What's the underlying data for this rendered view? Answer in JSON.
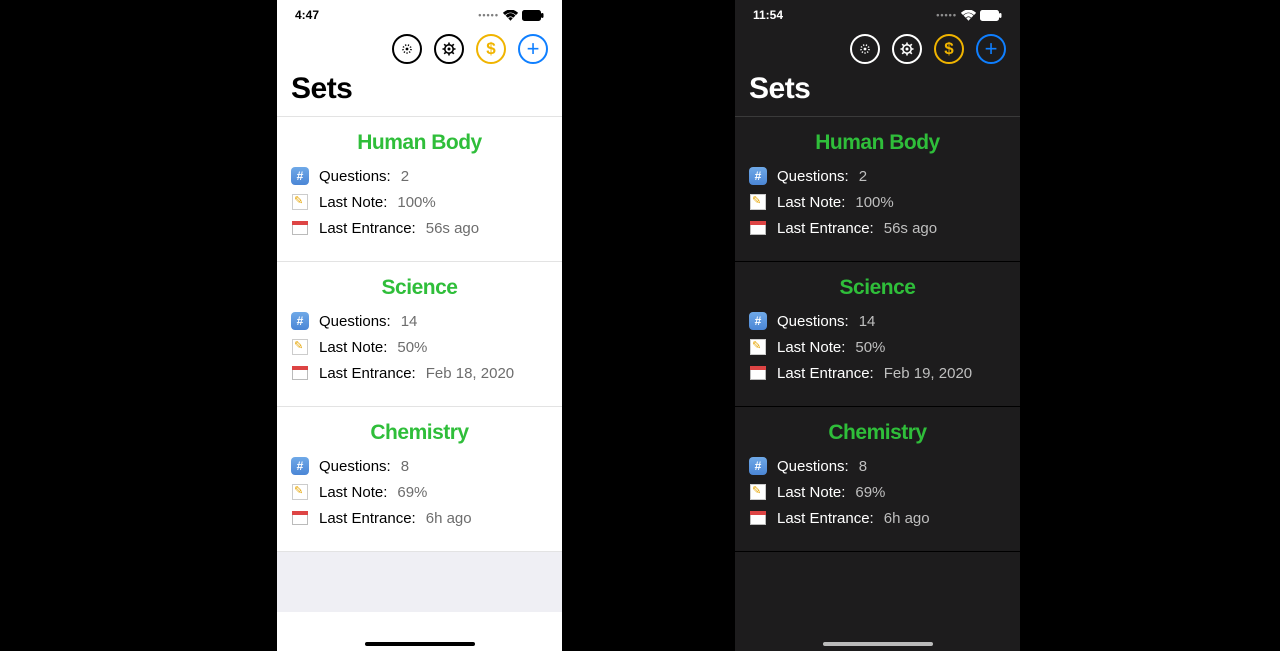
{
  "phones": [
    {
      "theme": "light",
      "status": {
        "time": "4:47"
      },
      "title": "Sets",
      "sets": [
        {
          "name": "Human Body",
          "questions": "2",
          "last_note": "100%",
          "last_entrance": "56s ago"
        },
        {
          "name": "Science",
          "questions": "14",
          "last_note": "50%",
          "last_entrance": "Feb 18, 2020"
        },
        {
          "name": "Chemistry",
          "questions": "8",
          "last_note": "69%",
          "last_entrance": "6h ago"
        }
      ]
    },
    {
      "theme": "dark",
      "status": {
        "time": "11:54"
      },
      "title": "Sets",
      "sets": [
        {
          "name": "Human Body",
          "questions": "2",
          "last_note": "100%",
          "last_entrance": "56s ago"
        },
        {
          "name": "Science",
          "questions": "14",
          "last_note": "50%",
          "last_entrance": "Feb 19, 2020"
        },
        {
          "name": "Chemistry",
          "questions": "8",
          "last_note": "69%",
          "last_entrance": "6h ago"
        }
      ]
    }
  ],
  "labels": {
    "questions": "Questions:",
    "last_note": "Last Note:",
    "last_entrance": "Last Entrance:"
  },
  "toolbar": {
    "dollar_glyph": "$",
    "plus_glyph": "+"
  }
}
